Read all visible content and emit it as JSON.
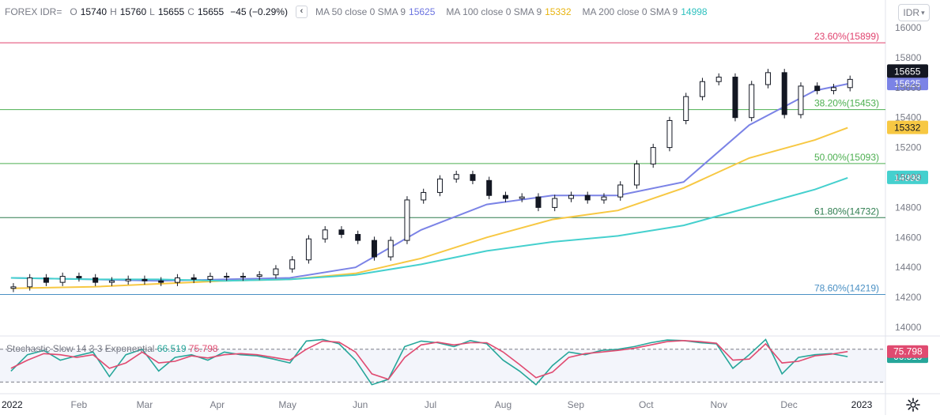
{
  "header": {
    "symbol": "FOREX IDR=",
    "o_label": "O",
    "o_value": "15740",
    "h_label": "H",
    "h_value": "15760",
    "l_label": "L",
    "l_value": "15655",
    "c_label": "C",
    "c_value": "15655",
    "change": "−45 (−0.29%)",
    "ma1_label": "MA 50 close 0 SMA 9",
    "ma1_value": "15625",
    "ma2_label": "MA 100 close 0 SMA 9",
    "ma2_value": "15332",
    "ma3_label": "MA 200 close 0 SMA 9",
    "ma3_value": "14998",
    "currency_button": "IDR",
    "collapse_icon": "chevron-left-icon",
    "currency_dropdown_icon": "chevron-down-icon"
  },
  "stochastic_legend": {
    "label": "Stochastic Slow 14 3 3 Exponential",
    "k_value": "66.519",
    "d_value": "75.798"
  },
  "colors": {
    "ma50": "#7b83e6",
    "ma100": "#f7c843",
    "ma200": "#45d0ce",
    "candle": "#131722",
    "stoch_k": "#26a69a",
    "stoch_d": "#e04a70",
    "fib_236": "#e0426e",
    "fib_382": "#4caf50",
    "fib_500": "#4caf50",
    "fib_618": "#2e7d4f",
    "fib_786": "#4a90c4"
  },
  "chart_data": [
    {
      "type": "candlestick",
      "title": "FOREX IDR=",
      "x_tick_labels": [
        "2022",
        "Feb",
        "Mar",
        "Apr",
        "May",
        "Jun",
        "Jul",
        "Aug",
        "Sep",
        "Oct",
        "Nov",
        "Dec",
        "2023"
      ],
      "y_tick_labels": [
        "16000",
        "15800",
        "15600",
        "15400",
        "15200",
        "15000",
        "14800",
        "14600",
        "14400",
        "14200",
        "14000"
      ],
      "ylim": [
        13940,
        16070
      ],
      "last_price_label": "15655",
      "ohlc_last": {
        "open": 15740,
        "high": 15760,
        "low": 15655,
        "close": 15655
      },
      "x": [
        "2022-01-03",
        "2022-01-10",
        "2022-01-17",
        "2022-01-24",
        "2022-01-31",
        "2022-02-07",
        "2022-02-14",
        "2022-02-21",
        "2022-02-28",
        "2022-03-07",
        "2022-03-14",
        "2022-03-21",
        "2022-03-28",
        "2022-04-04",
        "2022-04-11",
        "2022-04-18",
        "2022-04-25",
        "2022-05-02",
        "2022-05-09",
        "2022-05-16",
        "2022-05-23",
        "2022-05-30",
        "2022-06-06",
        "2022-06-13",
        "2022-06-20",
        "2022-06-27",
        "2022-07-04",
        "2022-07-11",
        "2022-07-18",
        "2022-07-25",
        "2022-08-01",
        "2022-08-08",
        "2022-08-15",
        "2022-08-22",
        "2022-08-29",
        "2022-09-05",
        "2022-09-12",
        "2022-09-19",
        "2022-09-26",
        "2022-10-03",
        "2022-10-10",
        "2022-10-17",
        "2022-10-24",
        "2022-10-31",
        "2022-11-07",
        "2022-11-14",
        "2022-11-21",
        "2022-11-28",
        "2022-12-05",
        "2022-12-12",
        "2022-12-19",
        "2022-12-26"
      ],
      "close": [
        14270,
        14330,
        14300,
        14340,
        14330,
        14300,
        14310,
        14320,
        14310,
        14300,
        14330,
        14320,
        14340,
        14335,
        14340,
        14350,
        14390,
        14450,
        14590,
        14650,
        14620,
        14580,
        14470,
        14580,
        14850,
        14900,
        14990,
        15020,
        14980,
        14880,
        14860,
        14870,
        14800,
        14860,
        14880,
        14850,
        14870,
        14950,
        15090,
        15200,
        15380,
        15540,
        15640,
        15670,
        15400,
        15620,
        15700,
        15420,
        15610,
        15580,
        15600,
        15655
      ],
      "series": [
        {
          "name": "MA 50 close 0 SMA 9",
          "value_label": "15625",
          "x": [
            "2022-01-03",
            "2022-02-07",
            "2022-03-07",
            "2022-04-04",
            "2022-05-02",
            "2022-05-30",
            "2022-06-27",
            "2022-07-25",
            "2022-08-22",
            "2022-09-19",
            "2022-10-17",
            "2022-11-14",
            "2022-12-12",
            "2022-12-26"
          ],
          "values": [
            14330,
            14320,
            14310,
            14320,
            14330,
            14400,
            14650,
            14820,
            14880,
            14880,
            14970,
            15350,
            15580,
            15625
          ]
        },
        {
          "name": "MA 100 close 0 SMA 9",
          "value_label": "15332",
          "x": [
            "2022-01-03",
            "2022-02-07",
            "2022-03-07",
            "2022-04-04",
            "2022-05-02",
            "2022-05-30",
            "2022-06-27",
            "2022-07-25",
            "2022-08-22",
            "2022-09-19",
            "2022-10-17",
            "2022-11-14",
            "2022-12-12",
            "2022-12-26"
          ],
          "values": [
            14260,
            14270,
            14290,
            14310,
            14320,
            14360,
            14460,
            14600,
            14720,
            14780,
            14930,
            15130,
            15250,
            15332
          ]
        },
        {
          "name": "MA 200 close 0 SMA 9",
          "value_label": "14998",
          "x": [
            "2022-01-03",
            "2022-02-07",
            "2022-03-07",
            "2022-04-04",
            "2022-05-02",
            "2022-05-30",
            "2022-06-27",
            "2022-07-25",
            "2022-08-22",
            "2022-09-19",
            "2022-10-17",
            "2022-11-14",
            "2022-12-12",
            "2022-12-26"
          ],
          "values": [
            14330,
            14320,
            14320,
            14310,
            14320,
            14350,
            14420,
            14510,
            14570,
            14610,
            14680,
            14800,
            14920,
            14998
          ]
        }
      ],
      "fibonacci": [
        {
          "label": "23.60%(15899)",
          "level": 15899
        },
        {
          "label": "38.20%(15453)",
          "level": 15453
        },
        {
          "label": "50.00%(15093)",
          "level": 15093
        },
        {
          "label": "61.80%(14732)",
          "level": 14732
        },
        {
          "label": "78.60%(14219)",
          "level": 14219
        }
      ]
    },
    {
      "type": "line",
      "title": "Stochastic Slow 14 3 3 Exponential",
      "ylim": [
        0,
        100
      ],
      "band": [
        20,
        80
      ],
      "x": [
        "2022-01-03",
        "2022-01-10",
        "2022-01-17",
        "2022-01-24",
        "2022-01-31",
        "2022-02-07",
        "2022-02-14",
        "2022-02-21",
        "2022-02-28",
        "2022-03-07",
        "2022-03-14",
        "2022-03-21",
        "2022-03-28",
        "2022-04-04",
        "2022-04-11",
        "2022-04-18",
        "2022-04-25",
        "2022-05-02",
        "2022-05-09",
        "2022-05-16",
        "2022-05-23",
        "2022-05-30",
        "2022-06-06",
        "2022-06-13",
        "2022-06-20",
        "2022-06-27",
        "2022-07-04",
        "2022-07-11",
        "2022-07-18",
        "2022-07-25",
        "2022-08-01",
        "2022-08-08",
        "2022-08-15",
        "2022-08-22",
        "2022-08-29",
        "2022-09-05",
        "2022-09-12",
        "2022-09-19",
        "2022-09-26",
        "2022-10-03",
        "2022-10-10",
        "2022-10-17",
        "2022-10-24",
        "2022-10-31",
        "2022-11-07",
        "2022-11-14",
        "2022-11-21",
        "2022-11-28",
        "2022-12-05",
        "2022-12-12",
        "2022-12-19",
        "2022-12-26"
      ],
      "series": [
        {
          "name": "%K",
          "value_label": "66.519",
          "values": [
            40,
            70,
            78,
            60,
            68,
            75,
            30,
            70,
            80,
            40,
            65,
            70,
            60,
            75,
            70,
            68,
            62,
            55,
            95,
            98,
            90,
            60,
            15,
            25,
            85,
            95,
            92,
            85,
            96,
            90,
            60,
            40,
            15,
            50,
            75,
            70,
            78,
            80,
            85,
            92,
            97,
            96,
            92,
            90,
            45,
            70,
            98,
            35,
            65,
            70,
            72,
            66.519
          ]
        },
        {
          "name": "%D",
          "value_label": "75.798",
          "values": [
            45,
            60,
            72,
            70,
            65,
            70,
            45,
            55,
            75,
            55,
            58,
            68,
            64,
            70,
            72,
            70,
            65,
            60,
            80,
            95,
            93,
            75,
            35,
            25,
            65,
            88,
            93,
            88,
            92,
            92,
            75,
            52,
            28,
            38,
            65,
            72,
            75,
            78,
            82,
            88,
            94,
            96,
            94,
            91,
            60,
            62,
            90,
            55,
            58,
            68,
            71,
            75.798
          ]
        }
      ]
    }
  ]
}
